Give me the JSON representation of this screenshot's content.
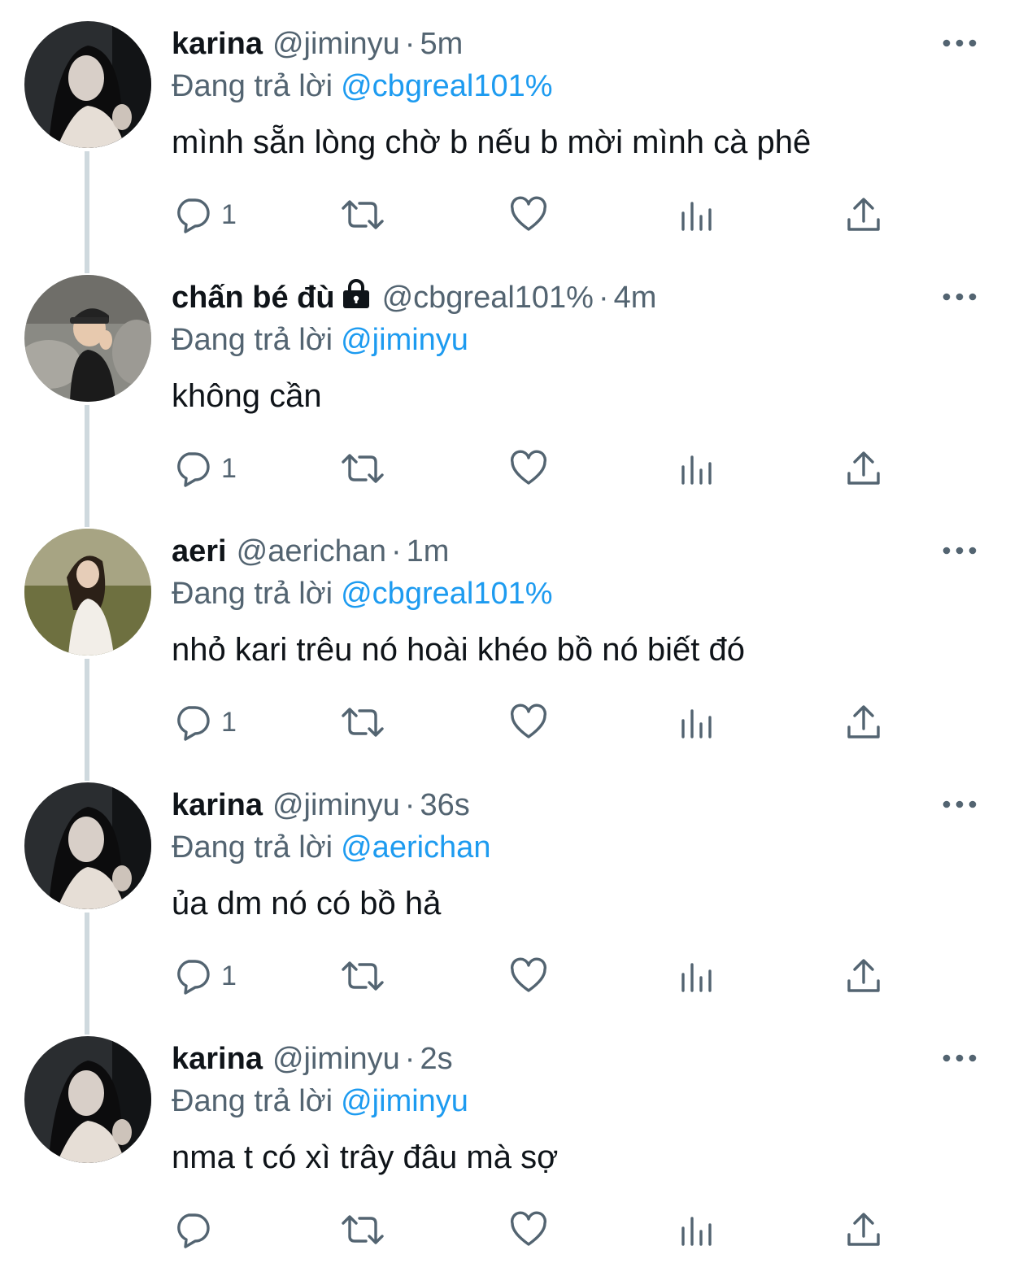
{
  "tweets": [
    {
      "name": "karina",
      "locked": false,
      "handle": "@jiminyu",
      "separator": "·",
      "time": "5m",
      "replying_label": "Đang trả lời",
      "replying_to": "@cbgreal101%",
      "text": "mình sẵn lòng chờ b nếu b mời mình cà phê",
      "reply_count": "1",
      "avatar_icon": "avatar-karina"
    },
    {
      "name": "chấn bé đù",
      "locked": true,
      "handle": "@cbgreal101%",
      "separator": "·",
      "time": "4m",
      "replying_label": "Đang trả lời",
      "replying_to": "@jiminyu",
      "text": "không cần",
      "reply_count": "1",
      "avatar_icon": "avatar-chan-be-du"
    },
    {
      "name": "aeri",
      "locked": false,
      "handle": "@aerichan",
      "separator": "·",
      "time": "1m",
      "replying_label": "Đang trả lời",
      "replying_to": "@cbgreal101%",
      "text": "nhỏ kari trêu nó hoài khéo bồ nó biết đó",
      "reply_count": "1",
      "avatar_icon": "avatar-aeri"
    },
    {
      "name": "karina",
      "locked": false,
      "handle": "@jiminyu",
      "separator": "·",
      "time": "36s",
      "replying_label": "Đang trả lời",
      "replying_to": "@aerichan",
      "text": "ủa dm nó có bồ hả",
      "reply_count": "1",
      "avatar_icon": "avatar-karina"
    },
    {
      "name": "karina",
      "locked": false,
      "handle": "@jiminyu",
      "separator": "·",
      "time": "2s",
      "replying_label": "Đang trả lời",
      "replying_to": "@jiminyu",
      "text": "nma t có xì trây đâu mà sợ",
      "reply_count": "",
      "avatar_icon": "avatar-karina"
    }
  ],
  "icons": {
    "more": "more-horizontal-icon",
    "reply": "reply-bubble-icon",
    "retweet": "retweet-icon",
    "like": "heart-icon",
    "stats": "analytics-bars-icon",
    "share": "share-upload-icon",
    "lock": "lock-icon"
  },
  "colors": {
    "text": "#0f1419",
    "secondary": "#536471",
    "link": "#1d9bf0",
    "thread_line": "#cfd9de"
  }
}
